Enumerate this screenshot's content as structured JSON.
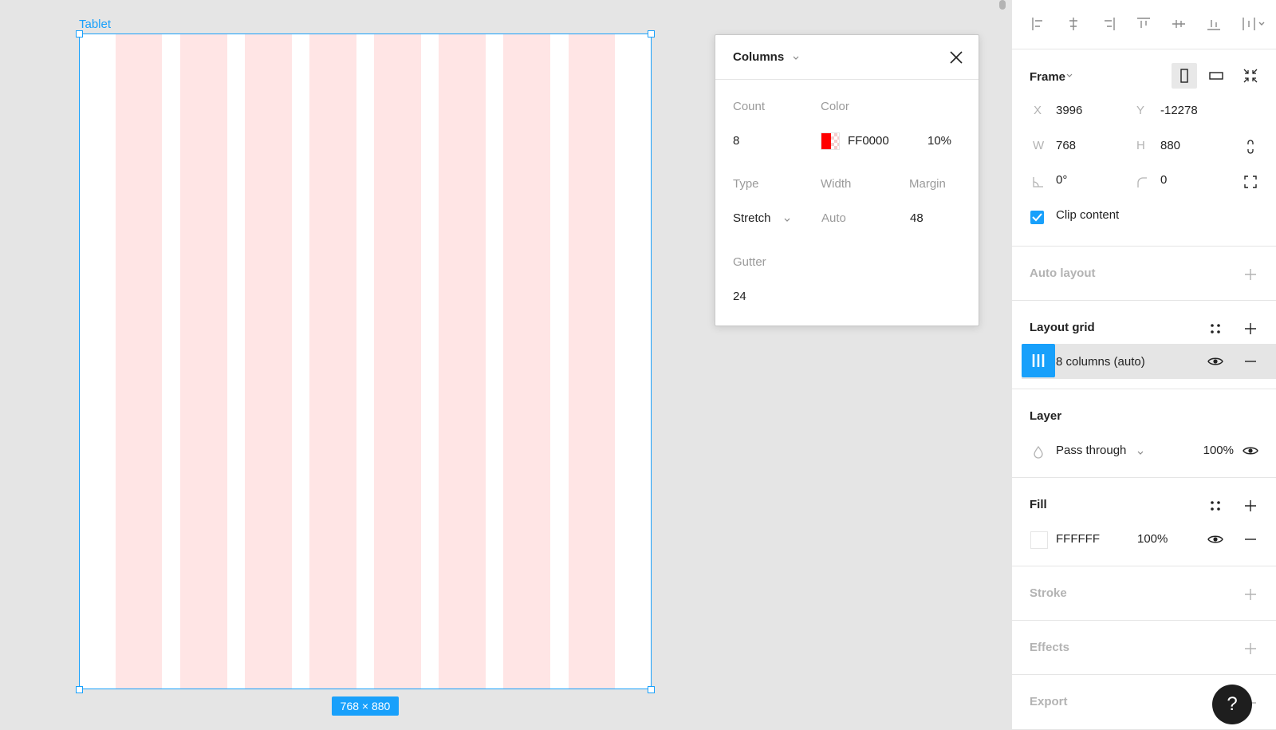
{
  "canvas": {
    "frame_label": "Tablet",
    "size_badge": "768 × 880",
    "grid_color": "#FF0000",
    "grid_opacity": 0.1
  },
  "popup": {
    "title": "Columns",
    "count_label": "Count",
    "count_value": "8",
    "color_label": "Color",
    "color_hex": "FF0000",
    "color_opacity": "10%",
    "type_label": "Type",
    "type_value": "Stretch",
    "width_label": "Width",
    "width_value": "Auto",
    "margin_label": "Margin",
    "margin_value": "48",
    "gutter_label": "Gutter",
    "gutter_value": "24"
  },
  "panel": {
    "frame": {
      "title": "Frame",
      "x_label": "X",
      "x_value": "3996",
      "y_label": "Y",
      "y_value": "-12278",
      "w_label": "W",
      "w_value": "768",
      "h_label": "H",
      "h_value": "880",
      "rotation_value": "0°",
      "radius_value": "0",
      "clip_label": "Clip content",
      "clip_checked": true
    },
    "auto_layout": {
      "title": "Auto layout"
    },
    "layout_grid": {
      "title": "Layout grid",
      "item_label": "8 columns (auto)"
    },
    "layer": {
      "title": "Layer",
      "blend": "Pass through",
      "opacity": "100%"
    },
    "fill": {
      "title": "Fill",
      "hex": "FFFFFF",
      "opacity": "100%"
    },
    "stroke": {
      "title": "Stroke"
    },
    "effects": {
      "title": "Effects"
    },
    "export": {
      "title": "Export"
    },
    "help_label": "?"
  },
  "colors": {
    "accent": "#18a0fb",
    "grid_fill": "#FF0000",
    "canvas_bg": "#e5e5e5"
  }
}
